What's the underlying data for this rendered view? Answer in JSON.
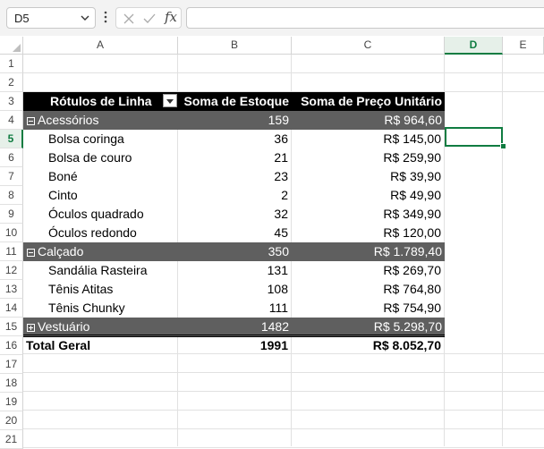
{
  "name_box": "D5",
  "formula_value": "",
  "fx_label": "fx",
  "columns": [
    "A",
    "B",
    "C",
    "D",
    "E"
  ],
  "selected_column": "D",
  "rows": [
    "1",
    "2",
    "3",
    "4",
    "5",
    "6",
    "7",
    "8",
    "9",
    "10",
    "11",
    "12",
    "13",
    "14",
    "15",
    "16",
    "17",
    "18",
    "19",
    "20",
    "21"
  ],
  "selected_row": "5",
  "pivot": {
    "headers": [
      "Rótulos de Linha",
      "Soma de Estoque",
      "Soma de Preço Unitário"
    ],
    "groups": [
      {
        "label": "Acessórios",
        "expanded": true,
        "stock": "159",
        "price": "R$ 964,60",
        "items": [
          {
            "label": "Bolsa coringa",
            "stock": "36",
            "price": "R$ 145,00"
          },
          {
            "label": "Bolsa de couro",
            "stock": "21",
            "price": "R$ 259,90"
          },
          {
            "label": "Boné",
            "stock": "23",
            "price": "R$ 39,90"
          },
          {
            "label": "Cinto",
            "stock": "2",
            "price": "R$ 49,90"
          },
          {
            "label": "Óculos quadrado",
            "stock": "32",
            "price": "R$ 349,90"
          },
          {
            "label": "Óculos redondo",
            "stock": "45",
            "price": "R$ 120,00"
          }
        ]
      },
      {
        "label": "Calçado",
        "expanded": true,
        "stock": "350",
        "price": "R$ 1.789,40",
        "items": [
          {
            "label": "Sandália Rasteira",
            "stock": "131",
            "price": "R$ 269,70"
          },
          {
            "label": "Tênis Atitas",
            "stock": "108",
            "price": "R$ 764,80"
          },
          {
            "label": "Tênis Chunky",
            "stock": "111",
            "price": "R$ 754,90"
          }
        ]
      },
      {
        "label": "Vestuário",
        "expanded": false,
        "stock": "1482",
        "price": "R$ 5.298,70",
        "items": []
      }
    ],
    "total": {
      "label": "Total Geral",
      "stock": "1991",
      "price": "R$ 8.052,70"
    }
  },
  "colors": {
    "accent": "#107c41",
    "group_band": "#5f5f5f",
    "header_band": "#000000"
  }
}
